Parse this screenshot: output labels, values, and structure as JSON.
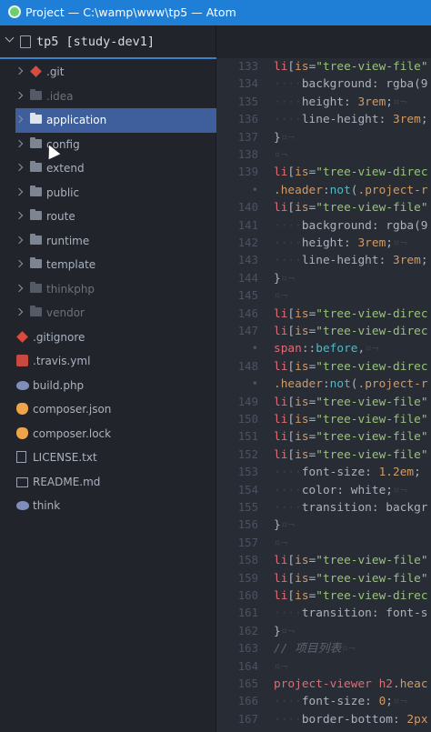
{
  "window": {
    "title": "Project — C:\\wamp\\www\\tp5 — Atom"
  },
  "tree": {
    "project_label": "tp5 [study-dev1]",
    "items": [
      {
        "type": "folder",
        "label": ".git",
        "icon": "git-icon",
        "dim": false
      },
      {
        "type": "folder",
        "label": ".idea",
        "icon": "folder-icon",
        "dim": true
      },
      {
        "type": "folder",
        "label": "application",
        "icon": "folder-open-icon",
        "selected": true
      },
      {
        "type": "folder",
        "label": "config",
        "icon": "folder-icon"
      },
      {
        "type": "folder",
        "label": "extend",
        "icon": "folder-icon"
      },
      {
        "type": "folder",
        "label": "public",
        "icon": "folder-icon"
      },
      {
        "type": "folder",
        "label": "route",
        "icon": "folder-icon"
      },
      {
        "type": "folder",
        "label": "runtime",
        "icon": "folder-icon"
      },
      {
        "type": "folder",
        "label": "template",
        "icon": "folder-icon"
      },
      {
        "type": "folder",
        "label": "thinkphp",
        "icon": "folder-icon",
        "dim": true
      },
      {
        "type": "folder",
        "label": "vendor",
        "icon": "folder-icon",
        "dim": true
      },
      {
        "type": "file",
        "label": ".gitignore",
        "icon": "git-icon"
      },
      {
        "type": "file",
        "label": ".travis.yml",
        "icon": "travis-icon"
      },
      {
        "type": "file",
        "label": "build.php",
        "icon": "php-icon"
      },
      {
        "type": "file",
        "label": "composer.json",
        "icon": "composer-icon"
      },
      {
        "type": "file",
        "label": "composer.lock",
        "icon": "composer-icon"
      },
      {
        "type": "file",
        "label": "LICENSE.txt",
        "icon": "document-icon"
      },
      {
        "type": "file",
        "label": "README.md",
        "icon": "readme-icon"
      },
      {
        "type": "file",
        "label": "think",
        "icon": "php-icon"
      }
    ]
  },
  "editor": {
    "lines": [
      {
        "num": "133",
        "html": "<span class='t'>li</span>[<span class='n'>is</span>=<span class='s'>\"tree-view-file\"</span>"
      },
      {
        "num": "134",
        "html": "<span class='inv'>····</span>background: rgba(9"
      },
      {
        "num": "135",
        "html": "<span class='inv'>····</span>height: <span class='n'>3rem</span>;<span class='inv'>¤¬</span>"
      },
      {
        "num": "136",
        "html": "<span class='inv'>····</span>line-height: <span class='n'>3rem</span>;"
      },
      {
        "num": "137",
        "html": "}<span class='inv'>¤¬</span>"
      },
      {
        "num": "138",
        "html": "<span class='inv'>¤¬</span>"
      },
      {
        "num": "139",
        "html": "<span class='t'>li</span>[<span class='n'>is</span>=<span class='s'>\"tree-view-direc</span>"
      },
      {
        "num": "•",
        "html": "<span class='cl'>.header</span>:<span class='fn'>not</span>(<span class='cl'>.project-r</span>"
      },
      {
        "num": "140",
        "html": "<span class='t'>li</span>[<span class='n'>is</span>=<span class='s'>\"tree-view-file\"</span>"
      },
      {
        "num": "141",
        "html": "<span class='inv'>····</span>background: rgba(9"
      },
      {
        "num": "142",
        "html": "<span class='inv'>····</span>height: <span class='n'>3rem</span>;<span class='inv'>¤¬</span>"
      },
      {
        "num": "143",
        "html": "<span class='inv'>····</span>line-height: <span class='n'>3rem</span>;"
      },
      {
        "num": "144",
        "html": "}<span class='inv'>¤¬</span>"
      },
      {
        "num": "145",
        "html": "<span class='inv'>¤¬</span>"
      },
      {
        "num": "146",
        "html": "<span class='t'>li</span>[<span class='n'>is</span>=<span class='s'>\"tree-view-direc</span>"
      },
      {
        "num": "147",
        "html": "<span class='t'>li</span>[<span class='n'>is</span>=<span class='s'>\"tree-view-direc</span>"
      },
      {
        "num": "•",
        "html": "<span class='t'>span</span>::<span class='fn'>before</span>,<span class='inv'>¤¬</span>"
      },
      {
        "num": "148",
        "html": "<span class='t'>li</span>[<span class='n'>is</span>=<span class='s'>\"tree-view-direc</span>"
      },
      {
        "num": "•",
        "html": "<span class='cl'>.header</span>:<span class='fn'>not</span>(<span class='cl'>.project-r</span>"
      },
      {
        "num": "149",
        "html": "<span class='t'>li</span>[<span class='n'>is</span>=<span class='s'>\"tree-view-file\"</span>"
      },
      {
        "num": "150",
        "html": "<span class='t'>li</span>[<span class='n'>is</span>=<span class='s'>\"tree-view-file\"</span>"
      },
      {
        "num": "151",
        "html": "<span class='t'>li</span>[<span class='n'>is</span>=<span class='s'>\"tree-view-file\"</span>"
      },
      {
        "num": "152",
        "html": "<span class='t'>li</span>[<span class='n'>is</span>=<span class='s'>\"tree-view-file\"</span>"
      },
      {
        "num": "153",
        "html": "<span class='inv'>····</span>font-size: <span class='n'>1.2em</span>;"
      },
      {
        "num": "154",
        "html": "<span class='inv'>····</span>color: white;<span class='inv'>¤¬</span>"
      },
      {
        "num": "155",
        "html": "<span class='inv'>····</span>transition: backgr"
      },
      {
        "num": "156",
        "html": "}<span class='inv'>¤¬</span>"
      },
      {
        "num": "157",
        "html": "<span class='inv'>¤¬</span>"
      },
      {
        "num": "158",
        "html": "<span class='t'>li</span>[<span class='n'>is</span>=<span class='s'>\"tree-view-file\"</span>"
      },
      {
        "num": "159",
        "html": "<span class='t'>li</span>[<span class='n'>is</span>=<span class='s'>\"tree-view-file\"</span>"
      },
      {
        "num": "160",
        "html": "<span class='t'>li</span>[<span class='n'>is</span>=<span class='s'>\"tree-view-direc</span>"
      },
      {
        "num": "161",
        "html": "<span class='inv'>····</span>transition: font-s"
      },
      {
        "num": "162",
        "html": "}<span class='inv'>¤¬</span>"
      },
      {
        "num": "163",
        "html": "<span class='c'>// 项目列表</span><span class='inv'>¤¬</span>"
      },
      {
        "num": "164",
        "html": "<span class='inv'>¤¬</span>"
      },
      {
        "num": "165",
        "html": "<span class='t'>project-viewer</span> <span class='t'>h2</span><span class='cl'>.heac</span>"
      },
      {
        "num": "166",
        "html": "<span class='inv'>····</span>font-size: <span class='n'>0</span>;<span class='inv'>¤¬</span>"
      },
      {
        "num": "167",
        "html": "<span class='inv'>····</span>border-bottom: <span class='n'>2px</span>"
      }
    ]
  },
  "colors": {
    "accent": "#1f7fd6",
    "selection": "#3e5f9c",
    "sidebar_bg": "#21252b",
    "editor_bg": "#282c34"
  }
}
